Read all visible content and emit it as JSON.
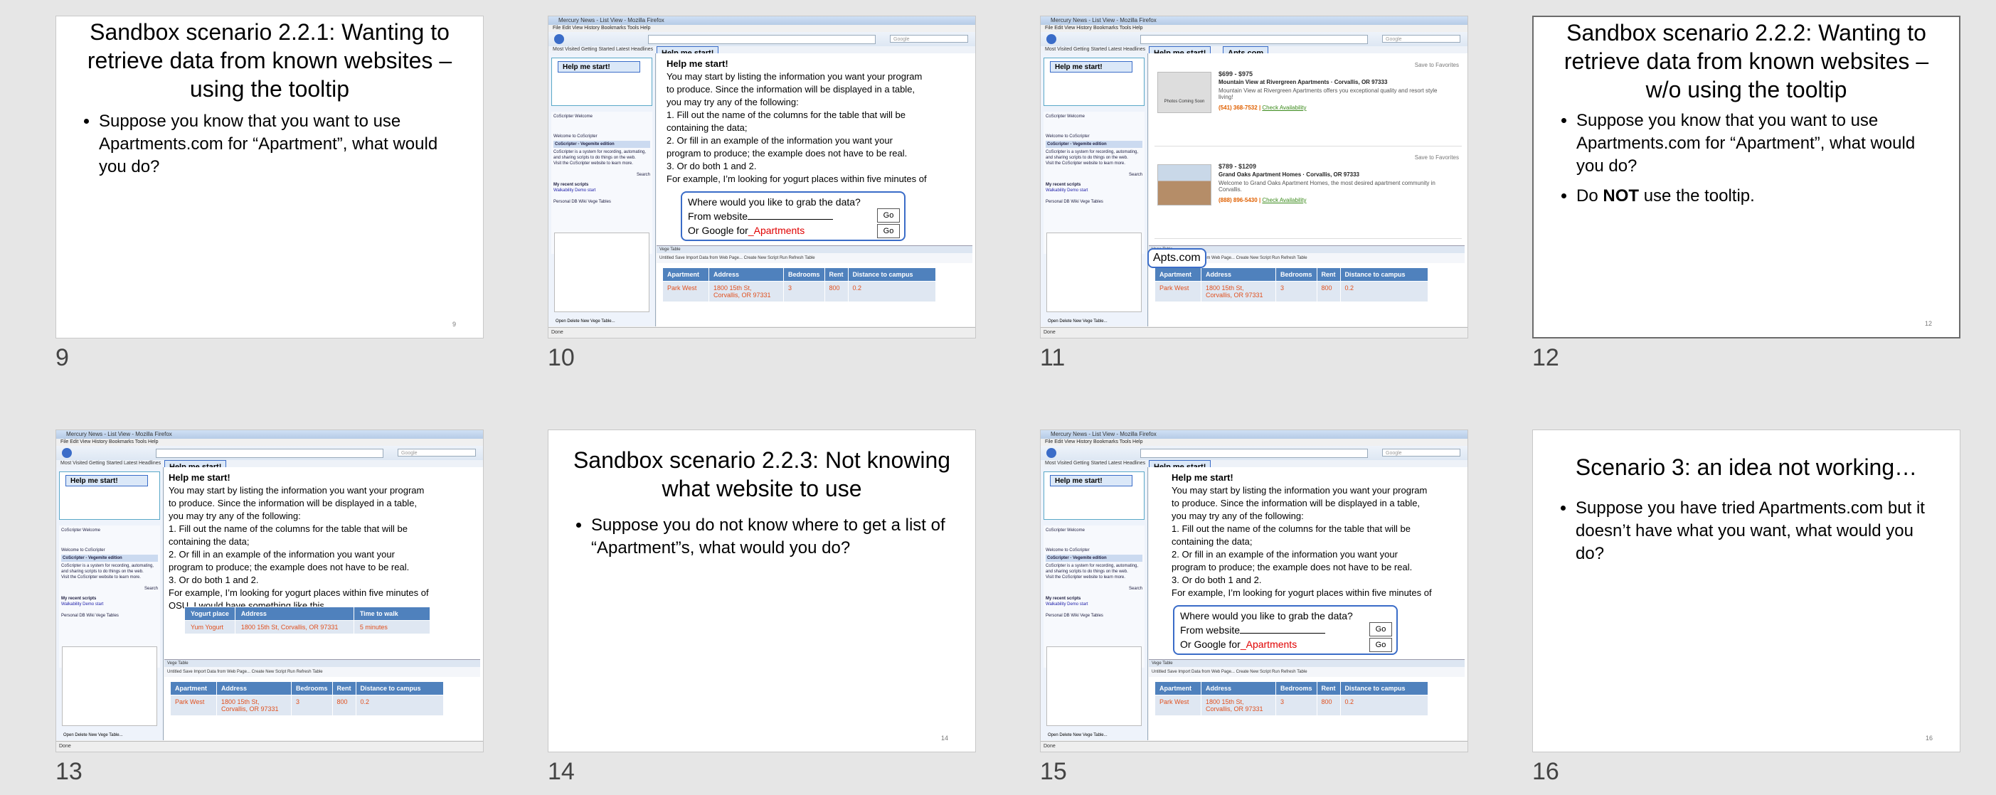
{
  "slides": {
    "s9": {
      "num": "9",
      "small_num": "9",
      "title": "Sandbox scenario 2.2.1: Wanting to retrieve data from known websites – using the tooltip",
      "bullets": [
        "Suppose you know that you want to use Apartments.com for “Apartment”, what would you do?"
      ]
    },
    "s10": {
      "num": "10",
      "small_num": "10"
    },
    "s11": {
      "num": "11",
      "small_num": "11"
    },
    "s12": {
      "num": "12",
      "small_num": "12",
      "title": "Sandbox scenario 2.2.2: Wanting to retrieve data from known websites – w/o using the tooltip",
      "bullet1": "Suppose you know that you want to use Apartments.com for “Apartment”, what would you do?",
      "bullet2_pre": "Do ",
      "bullet2_bold": "NOT",
      "bullet2_post": " use the tooltip."
    },
    "s13": {
      "num": "13",
      "small_num": "13"
    },
    "s14": {
      "num": "14",
      "small_num": "14",
      "title": "Sandbox scenario 2.2.3: Not knowing what website to use",
      "bullets": [
        "Suppose you do not know where to get a list of “Apartment”s, what would you do?"
      ]
    },
    "s15": {
      "num": "15",
      "small_num": "15"
    },
    "s16": {
      "num": "16",
      "small_num": "16",
      "title": "Scenario 3: an idea not working…",
      "bullets": [
        "Suppose you have tried Apartments.com but it doesn’t have what you want, what would you do?"
      ]
    }
  },
  "browser": {
    "title": "Mercury News - List View - Mozilla Firefox",
    "menu": "File  Edit  View  History  Bookmarks  Tools  Help",
    "bookmarks": "Most Visited   Getting Started   Latest Headlines",
    "search_placeholder": "Google",
    "status": "Done",
    "sidebar_btn": "Help me start!",
    "sidebar_title": "CoScripter Welcome",
    "sidebar_welcome": "Welcome to CoScripter",
    "sidebar_edition": "CoScripter - Vegemite edition",
    "sidebar_desc": "CoScripter is a system for recording, automating, and sharing scripts to do things on the web.",
    "sidebar_link": "Visit the CoScripter website to learn more.",
    "sidebar_search": "Search",
    "sidebar_recent": "My recent scripts",
    "sidebar_recent_item": "Walkability Demo start",
    "sidebar_tabs": "Personal DB   Wiki   Vege Tables",
    "sidebar_buttons": "Open   Delete   New Vege Table..."
  },
  "help": {
    "tip_label": "Help me start!",
    "heading": "Help me start!",
    "lines": [
      "You may start by listing the information you want your program",
      "to produce. Since the information will be displayed in a table,",
      "you may try any of the following:",
      "1. Fill out the name of the columns for the table that will be",
      "containing the data;",
      "2. Or fill in an example of the information you want your",
      "program to produce; the example does not have to be real.",
      "3. Or do both 1 and 2.",
      "For example, I’m looking for yogurt places within five minutes of",
      "OSU, I would have something like this"
    ]
  },
  "callout": {
    "question": "Where would you like to grab the data?",
    "from_website": "From website",
    "or_google": "Or Google for",
    "query": "_Apartments",
    "go": "Go"
  },
  "apts_tab": "Apts.com",
  "apts_bubble": "Apts.com",
  "vege_table": {
    "title": "Vege Table",
    "tools": "Untitled   Save   Import Data from Web Page...   Create New Script   Run   Refresh Table",
    "headers": [
      "Apartment",
      "Address",
      "Bedrooms",
      "Rent",
      "Distance to campus"
    ],
    "row": [
      "Park West",
      "1800 15th St, Corvallis, OR 97331",
      "3",
      "800",
      "0.2"
    ]
  },
  "yogurt_table": {
    "headers": [
      "Yogurt place",
      "Address",
      "Time to walk"
    ],
    "row": [
      "Yum Yogurt",
      "1800 15th St, Corvallis, OR 97331",
      "5 minutes"
    ]
  },
  "listings": [
    {
      "price": "$699 - $975",
      "name": "Mountain View at Rivergreen Apartments · Corvallis, OR 97333",
      "desc": "Mountain View at Rivergreen Apartments offers you exceptional quality and resort style living!",
      "phone": "(541) 368-7532",
      "link": "Check Availability",
      "save": "Save to Favorites",
      "photo": "Photos Coming Soon"
    },
    {
      "price": "$789 - $1209",
      "name": "Grand Oaks Apartment Homes · Corvallis, OR 97333",
      "desc": "Welcome to Grand Oaks Apartment Homes, the most desired apartment community in Corvallis.",
      "phone": "(888) 896-5430",
      "link": "Check Availability",
      "save": "Save to Favorites"
    }
  ]
}
